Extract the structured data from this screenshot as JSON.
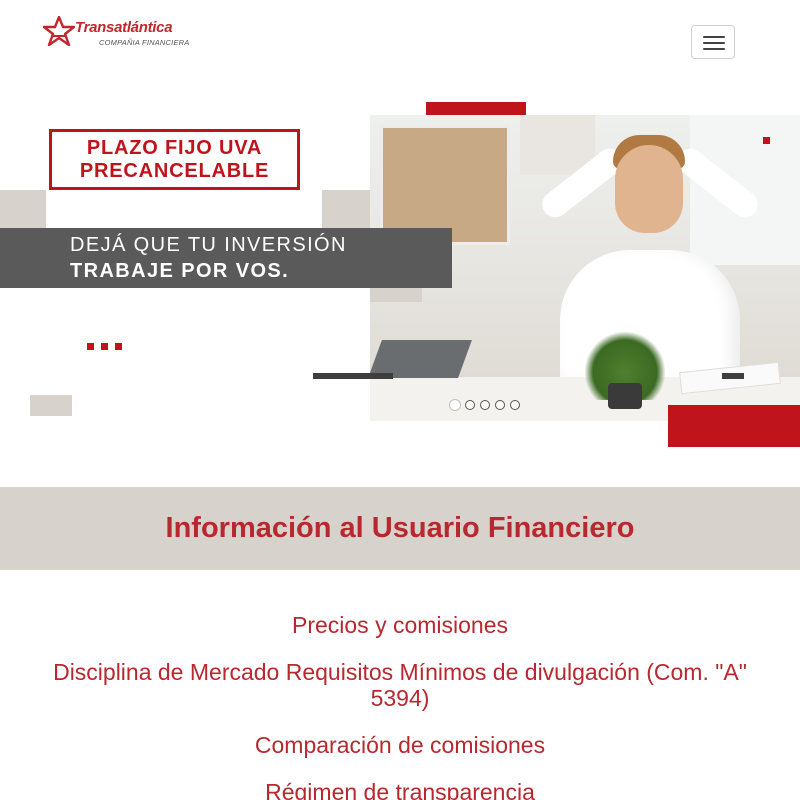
{
  "header": {
    "logo": {
      "name": "Transatlántica",
      "subtitle": "COMPAÑIA FINANCIERA"
    },
    "menu_toggle_icon": "hamburger-menu-icon"
  },
  "banner": {
    "headline_lines": [
      "PLAZO FIJO UVA",
      "PRECANCELABLE"
    ],
    "slogan_lines": [
      "DEJÁ QUE TU INVERSIÓN",
      "TRABAJE POR VOS."
    ],
    "slide_count": 5,
    "active_slide": 1,
    "colors": {
      "brand_red": "#c0141c",
      "slogan_gray": "#5a5a5a",
      "accent_beige": "#d7d3cc"
    }
  },
  "info": {
    "title": "Información al Usuario Financiero",
    "links": [
      "Precios y comisiones",
      "Disciplina de Mercado Requisitos Mínimos de divulgación (Com. \"A\" 5394)",
      "Comparación de comisiones",
      "Régimen de transparencia"
    ],
    "colors": {
      "link_red": "#b8282f",
      "band_bg": "#d7d3cc"
    }
  }
}
